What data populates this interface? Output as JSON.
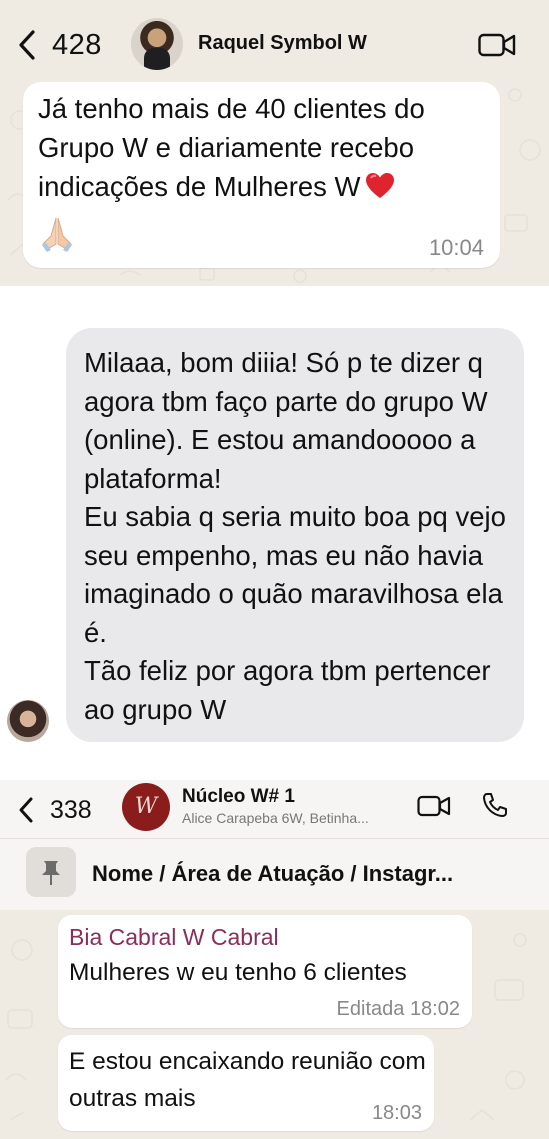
{
  "chat1": {
    "back_count": "428",
    "contact_name": "Raquel Symbol W",
    "message": "Já tenho mais de 40 clientes do Grupo W e diariamente recebo indicações de Mulheres W",
    "time": "10:04",
    "icons": [
      "back-chevron-icon",
      "video-call-icon",
      "red-heart-emoji",
      "folded-hands-emoji"
    ]
  },
  "imessage": {
    "paragraphs": [
      "Milaaa, bom diiia! Só p te dizer q agora tbm faço parte do grupo W (online). E estou amandooooo a plataforma!",
      "Eu sabia q seria muito boa pq vejo seu empenho, mas eu não havia imaginado o quão maravilhosa ela é.",
      "Tão feliz por agora tbm pertencer ao grupo W"
    ]
  },
  "group": {
    "back_count": "338",
    "avatar_text": "W",
    "name": "Núcleo W# 1",
    "members": "Alice Carapeba 6W, Betinha...",
    "pinned": "Nome / Área de Atuação / Instagr...",
    "messages": [
      {
        "sender": "Bia Cabral W Cabral",
        "text": "Mulheres w eu tenho 6 clientes",
        "edited": "Editada",
        "time": "18:02"
      },
      {
        "text": "E estou encaixando reunião com outras mais",
        "time": "18:03"
      }
    ],
    "colors": {
      "sender": "#8a2d5a",
      "avatar_bg": "#8b1c1c"
    }
  }
}
